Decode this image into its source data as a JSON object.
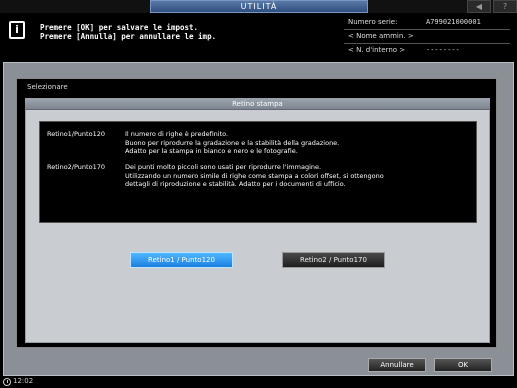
{
  "header": {
    "title": "UTILITÀ",
    "sys_buttons": [
      "◀",
      "?"
    ]
  },
  "message": {
    "line1": "Premere [OK] per salvare le impost.",
    "line2": "Premere [Annulla] per annullare le imp."
  },
  "device_info": {
    "serial_label": "Numero serie:",
    "serial_value": "A799021000001",
    "admin_label": "< Nome ammin. >",
    "internal_label": "< N. d'interno >",
    "internal_value": "--------"
  },
  "dialog": {
    "title": "Selezionare",
    "section_title": "Retino stampa",
    "descriptions": [
      {
        "label": "Retino1/Punto120",
        "lines": [
          "Il numero di righe è predefinito.",
          "Buono per riprodurre la gradazione e la stabilità della gradazione.",
          "Adatto per la stampa in bianco e nero e le fotografie."
        ]
      },
      {
        "label": "Retino2/Punto170",
        "lines": [
          "Dei punti molto piccoli sono usati per riprodurre l'immagine.",
          "Utilizzando un numero simile di righe come stampa a colori offset, si ottengono",
          "dettagli di riproduzione e stabilità. Adatto per i documenti di ufficio."
        ]
      }
    ],
    "options": [
      {
        "label": "Retino1 / Punto120",
        "selected": true
      },
      {
        "label": "Retino2 / Punto170",
        "selected": false
      }
    ]
  },
  "footer": {
    "cancel_label": "Annullare",
    "ok_label": "OK"
  },
  "status": {
    "time": "12:02"
  },
  "colors": {
    "selected_button": "#1b7fe0",
    "header_tab": "#2f4f80",
    "frame": "#8a9096"
  }
}
